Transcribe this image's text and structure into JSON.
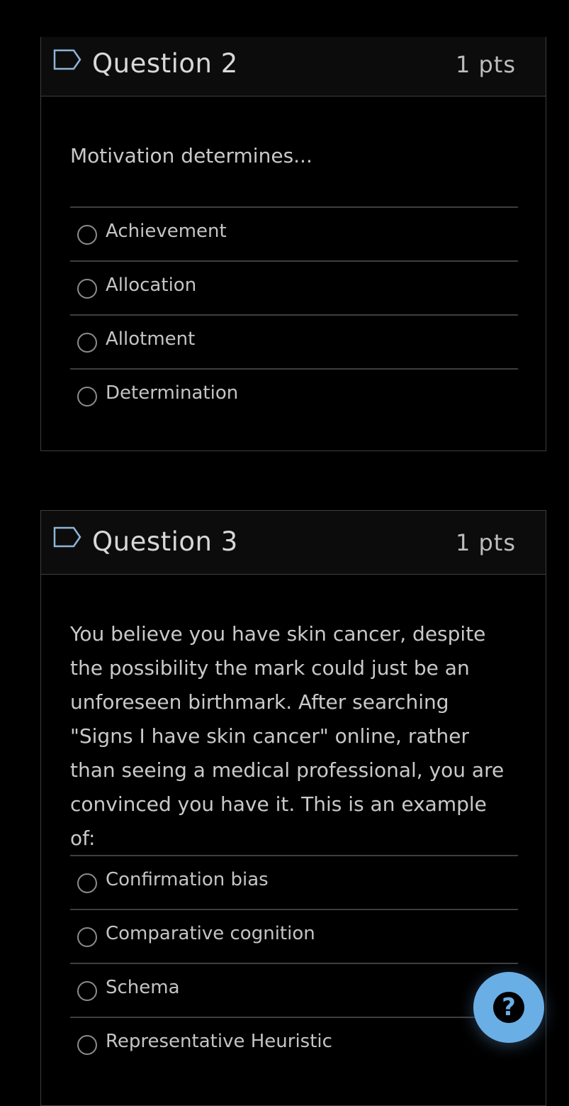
{
  "questions": [
    {
      "title": "Question 2",
      "points": "1 pts",
      "text": "Motivation determines...",
      "answers": [
        "Achievement",
        "Allocation",
        "Allotment",
        "Determination"
      ]
    },
    {
      "title": "Question 3",
      "points": "1 pts",
      "text": "You believe you have skin cancer, despite the possibility the mark could just be an unforeseen birthmark. After searching \"Signs I have skin cancer\" online, rather than seeing a medical professional, you are convinced you have it. This is an example of:",
      "answers": [
        "Confirmation bias",
        "Comparative cognition",
        "Schema",
        "Representative Heuristic"
      ]
    }
  ],
  "help": {
    "icon": "question-circle-icon",
    "label": "?"
  },
  "colors": {
    "background": "#000000",
    "border": "#3e3e3e",
    "help_button": "#6aaee6"
  }
}
